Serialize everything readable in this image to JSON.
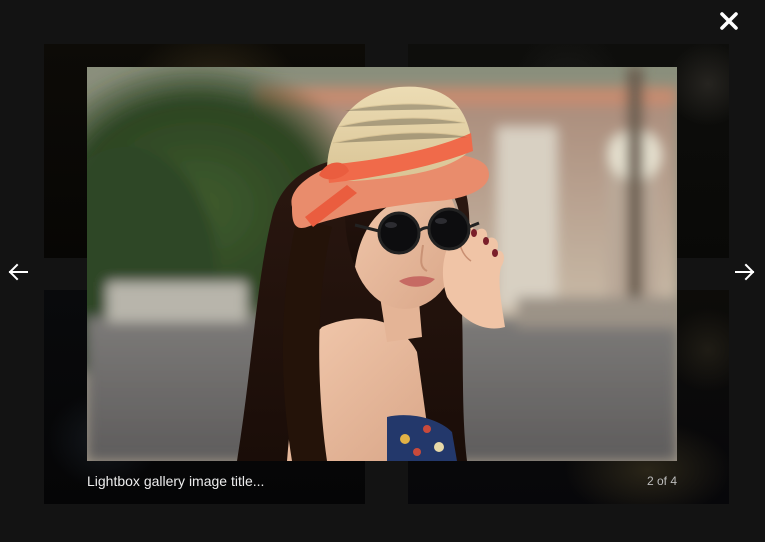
{
  "lightbox": {
    "caption_title": "Lightbox gallery image title...",
    "counter": "2 of 4",
    "current_index": 2,
    "total": 4
  },
  "controls": {
    "close_icon": "close-icon",
    "prev_icon": "arrow-left-icon",
    "next_icon": "arrow-right-icon"
  },
  "image": {
    "subject": "woman-in-hat-and-sunglasses"
  },
  "colors": {
    "backdrop": "#131313",
    "caption_text": "#eeeeee",
    "counter_text": "#bdbdbd",
    "control_white": "#ffffff"
  }
}
